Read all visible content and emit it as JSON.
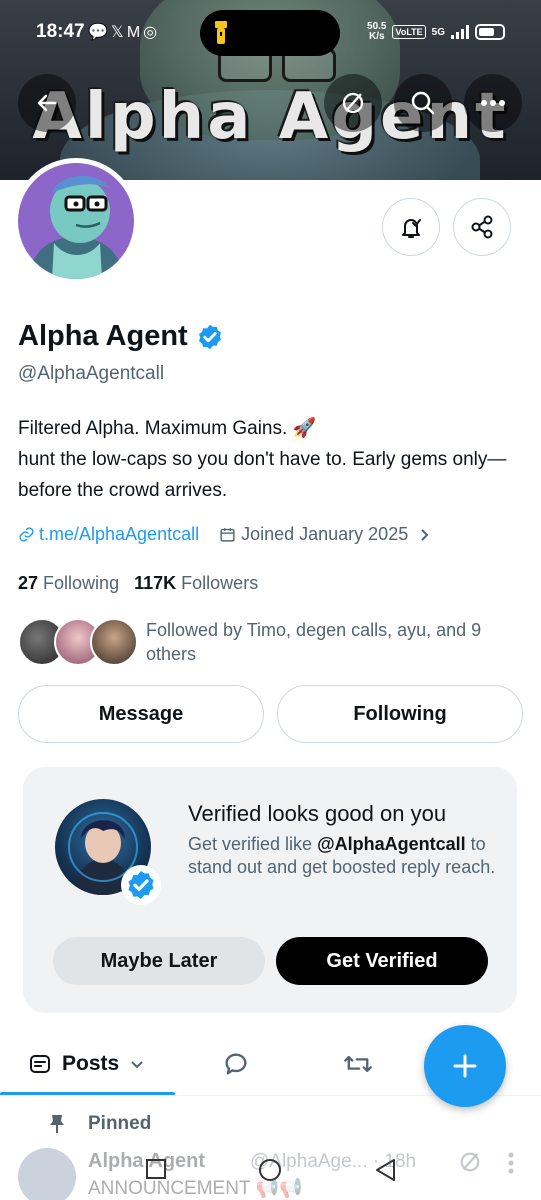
{
  "status_bar": {
    "time": "18:47",
    "network_speed_value": "50.5",
    "network_speed_unit": "K/s",
    "volte": "VoLTE",
    "network": "5G"
  },
  "banner": {
    "title": "Alpha Agent"
  },
  "nav": {
    "back_icon": "arrow-left-icon",
    "premium_icon": "grok-icon",
    "search_icon": "search-icon",
    "more_icon": "more-horizontal-icon"
  },
  "profile": {
    "name": "Alpha Agent",
    "handle": "@AlphaAgentcall",
    "bio_line1": "Filtered Alpha. Maximum Gains. 🚀",
    "bio_line2": "hunt the low-caps so you don't have to. Early gems only—before the crowd arrives.",
    "link": "t.me/AlphaAgentcall",
    "joined": "Joined January 2025",
    "following_count": "27",
    "following_label": "Following",
    "followers_count": "117K",
    "followers_label": "Followers",
    "followed_by": "Followed by Timo, degen calls, ayu, and 9 others"
  },
  "actions": {
    "message": "Message",
    "following": "Following"
  },
  "verified_card": {
    "title": "Verified looks good on you",
    "desc_prefix": "Get verified like ",
    "desc_handle": "@AlphaAgentcall",
    "desc_suffix": " to stand out and get boosted reply reach.",
    "maybe_later": "Maybe Later",
    "get_verified": "Get Verified"
  },
  "tabs": {
    "posts": "Posts"
  },
  "pinned": {
    "label": "Pinned"
  },
  "post_preview": {
    "name": "Alpha Agent",
    "handle": "@AlphaAge...",
    "time": "18h",
    "text": "ANNOUNCEMENT 📢📢"
  },
  "colors": {
    "accent": "#1d9bf0",
    "text": "#0f1419",
    "muted": "#536471",
    "border": "#cfd9de",
    "card_bg": "#f0f2f4"
  }
}
